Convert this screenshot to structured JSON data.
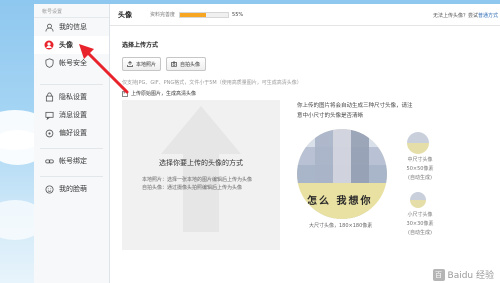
{
  "sidebar": {
    "header": "帐号设置",
    "items": [
      {
        "label": "我的信息",
        "icon": "user-icon"
      },
      {
        "label": "头像",
        "icon": "avatar-icon",
        "active": true
      },
      {
        "label": "帐号安全",
        "icon": "shield-icon"
      },
      {
        "label": "隐私设置",
        "icon": "lock-icon"
      },
      {
        "label": "消息设置",
        "icon": "message-icon"
      },
      {
        "label": "偏好设置",
        "icon": "preference-icon"
      },
      {
        "label": "帐号绑定",
        "icon": "link-icon"
      },
      {
        "label": "我的脸萌",
        "icon": "face-icon"
      }
    ]
  },
  "topbar": {
    "title": "头像",
    "completeness_label": "资料完善度",
    "completeness_value": 55,
    "completeness_text": "55%",
    "right_text": "无法上传头像？尝试",
    "right_link": "普通方式"
  },
  "upload": {
    "section_title": "选择上传方式",
    "local_button": "本地照片",
    "selfie_button": "自拍头像",
    "hint": "仅支持JPG、GIF、PNG格式，文件小于5M（使用高质量图片，可生成高清头像）",
    "hd_checkbox_label": "上传原始图片，生成高清头像",
    "hd_checked": true,
    "area_title": "选择你要上传的头像的方式",
    "desc_line1": "本地照片：选择一张本地的图片编辑后上传为头像",
    "desc_line2": "自拍头像：通过摄像头拍照编辑后上传为头像"
  },
  "preview": {
    "description": "你上传的图片将会自动生成三种尺寸头像，请注意中小尺寸的头像是否清晰",
    "photo_text": "怎么 我想你",
    "large_caption": "大尺寸头像，180×180像素",
    "medium_caption": [
      "中尺寸头像",
      "50×50像素",
      "(自动生成)"
    ],
    "small_caption": [
      "小尺寸头像",
      "30×30像素",
      "(自动生成)"
    ]
  },
  "watermark": {
    "badge": "百",
    "text": "Baidu 经验"
  },
  "colors": {
    "progress_fill": "#f6a623",
    "arrow_red": "#e8232b",
    "link_blue": "#2b6ab5"
  }
}
